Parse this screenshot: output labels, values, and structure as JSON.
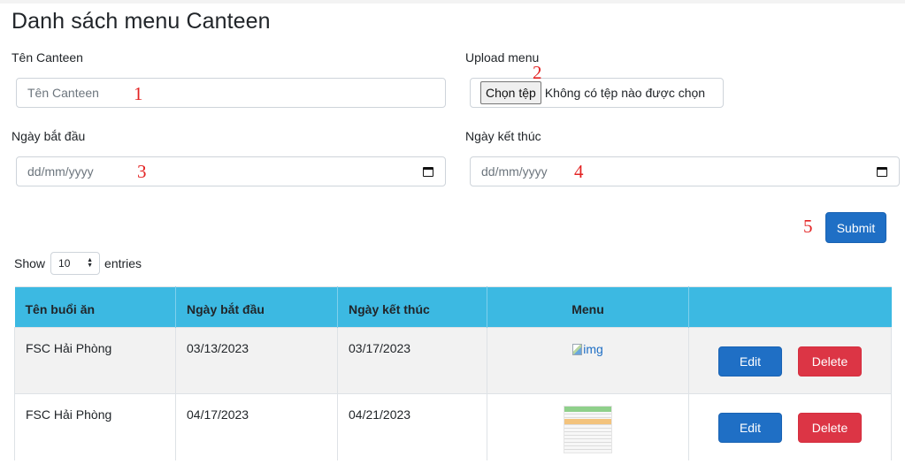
{
  "page": {
    "title": "Danh sách menu Canteen"
  },
  "form": {
    "canteen_label": "Tên Canteen",
    "canteen_placeholder": "Tên Canteen",
    "upload_label": "Upload menu",
    "file_button": "Chọn tệp",
    "file_status": "Không có tệp nào được chọn",
    "start_label": "Ngày bắt đầu",
    "start_placeholder": "dd/mm/yyyy",
    "end_label": "Ngày kết thúc",
    "end_placeholder": "dd/mm/yyyy",
    "submit": "Submit"
  },
  "annotations": [
    "1",
    "2",
    "3",
    "4",
    "5"
  ],
  "table_controls": {
    "show": "Show",
    "entries_value": "10",
    "entries": "entries"
  },
  "table": {
    "headers": [
      "Tên buổi ăn",
      "Ngày bắt đầu",
      "Ngày kết thúc",
      "Menu",
      ""
    ],
    "rows": [
      {
        "name": "FSC Hải Phòng",
        "start": "03/13/2023",
        "end": "03/17/2023",
        "menu_alt": "img",
        "menu_type": "broken-image",
        "edit": "Edit",
        "delete": "Delete"
      },
      {
        "name": "FSC Hải Phòng",
        "start": "04/17/2023",
        "end": "04/21/2023",
        "menu_alt": "",
        "menu_type": "thumbnail",
        "edit": "Edit",
        "delete": "Delete"
      }
    ]
  },
  "colors": {
    "header_bg": "#3cb9e2",
    "primary": "#1f6fc5",
    "danger": "#dc3545",
    "annotation": "#e32323"
  }
}
